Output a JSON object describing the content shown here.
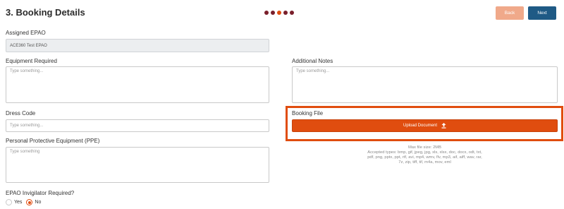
{
  "header": {
    "title": "3. Booking Details",
    "back_label": "Back",
    "next_label": "Next"
  },
  "progress": {
    "steps": 5,
    "current": 3,
    "colors": [
      "#7a1f2b",
      "#7a1f2b",
      "#e04d0f",
      "#7a1f2b",
      "#7a1f2b"
    ]
  },
  "form": {
    "assigned_epao": {
      "label": "Assigned EPAO",
      "value": "ACE360 Test EPAO"
    },
    "equipment_required": {
      "label": "Equipment Required",
      "placeholder": "Type something..."
    },
    "dress_code": {
      "label": "Dress Code",
      "placeholder": "Type something..."
    },
    "ppe": {
      "label": "Personal Protective Equipment (PPE)",
      "placeholder": "Type something"
    },
    "invigilator": {
      "label": "EPAO Invigilator Required?",
      "options": [
        "Yes",
        "No"
      ],
      "selected": "No"
    },
    "additional_notes": {
      "label": "Additional Notes",
      "placeholder": "Type something..."
    },
    "booking_file": {
      "label": "Booking File",
      "upload_label": "Upload Document",
      "max_size": "Max file size: 2MB",
      "accepted_types": [
        "Accepted types: bmp, gif, jpeg, jpg, xls, xlsx, doc, docx, odt, txt,",
        "pdf, png, pptx, ppt, rtf, avi, mp4, wmv, flv, mp3, aif, aiff, wav, rar,",
        "7z, zip, tiff, tif, m4a, mov, eml"
      ]
    }
  },
  "colors": {
    "accent": "#e04d0f",
    "back_button": "#f0a98a",
    "next_button": "#1f5a85",
    "dot_dark": "#7a1f2b"
  }
}
